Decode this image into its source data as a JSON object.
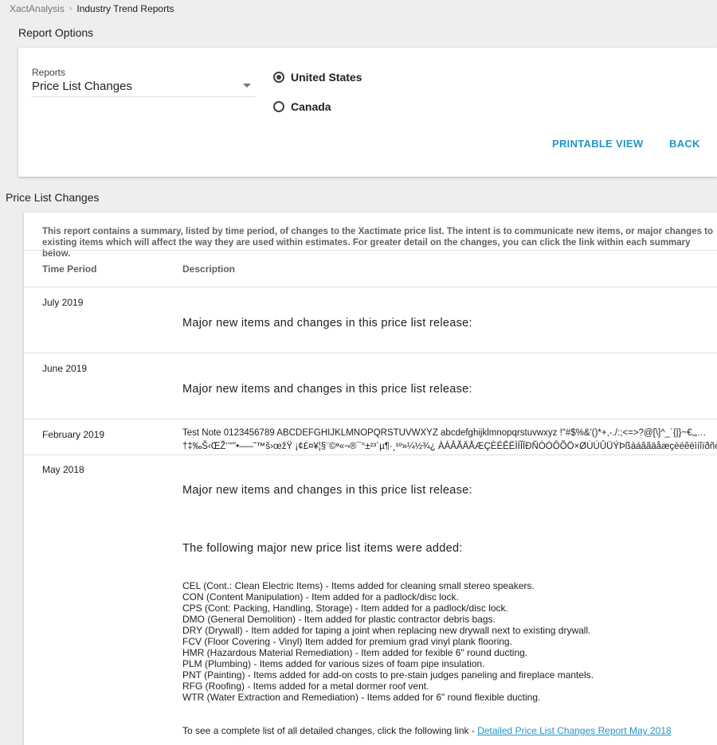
{
  "breadcrumb": {
    "root": "XactAnalysis",
    "separator": "›",
    "current": "Industry Trend Reports"
  },
  "report_options": {
    "title": "Report Options",
    "select": {
      "label": "Reports",
      "value": "Price List Changes"
    },
    "radios": [
      {
        "label": "United States",
        "checked": true
      },
      {
        "label": "Canada",
        "checked": false
      }
    ],
    "printable_view": "PRINTABLE VIEW",
    "back": "BACK"
  },
  "report": {
    "title": "Price List Changes",
    "intro_line1": "This report contains a summary, listed by time period, of changes to the Xactimate price list. The intent is to communicate new items, or major changes to",
    "intro_line2": "existing items which will affect the way they are used within estimates. For greater detail on the changes, you can click the link within each summary below.",
    "columns": {
      "time_period": "Time Period",
      "description": "Description"
    },
    "rows": [
      {
        "period": "July 2019",
        "desc": "Major new items and changes in this price list release:"
      },
      {
        "period": "June 2019",
        "desc": "Major new items and changes in this price list release:"
      },
      {
        "period": "February 2019",
        "note_line1": "Test Note 0123456789 ABCDEFGHIJKLMNOPQRSTUVWXYZ abcdefghijklmnopqrstuvwxyz !\"#$%&'()*+,-./:;<=>?@[\\]^_`{|}~€‚„…",
        "note_line2": "†‡‰Š‹ŒŽ‘’“”•–—˜™š›œžŸ ¡¢£¤¥¦§¨©ª«¬®¯°±²³´µ¶·¸¹º»¼½¾¿ ÀÁÂÃÄÅÆÇÈÉÊËÌÍÎÏÐÑÒÓÔÕÖ×ØÙÚÛÜÝÞßàáâãäåæçèéêëìíîïðñò"
      },
      {
        "period": "May 2018",
        "desc": "Major new items and changes in this price list release:",
        "subheading": "The following major new price list items were added:",
        "items": [
          "CEL (Cont.: Clean Electric Items) - Items added for cleaning small stereo speakers.",
          "CON (Content Manipulation) - Item added for a padlock/disc lock.",
          "CPS (Cont: Packing, Handling, Storage) - Item added for a padlock/disc lock.",
          "DMO (General Demolition) - Item added for plastic contractor debris bags.",
          "DRY (Drywall) - Item added for taping a joint when replacing new drywall next to existing drywall.",
          "FCV (Floor Covering - Vinyl) Item added for premium grad vinyl plank flooring.",
          "HMR (Hazardous Material Remediation) - Item added for fexible 6\" round ducting.",
          "PLM (Plumbing) - Items added for various sizes of foam pipe insulation.",
          "PNT (Painting) - Items added for add-on costs to pre-stain judges paneling and fireplace mantels.",
          "RFG (Roofing) - Items added for a metal dormer roof vent.",
          "WTR (Water Extraction and Remediation) - Items added for 6\" round flexible ducting."
        ],
        "link_prefix": "To see a complete list of all detailed changes, click the following link - ",
        "link_text": "Detailed Price List Changes Report May 2018"
      }
    ]
  }
}
